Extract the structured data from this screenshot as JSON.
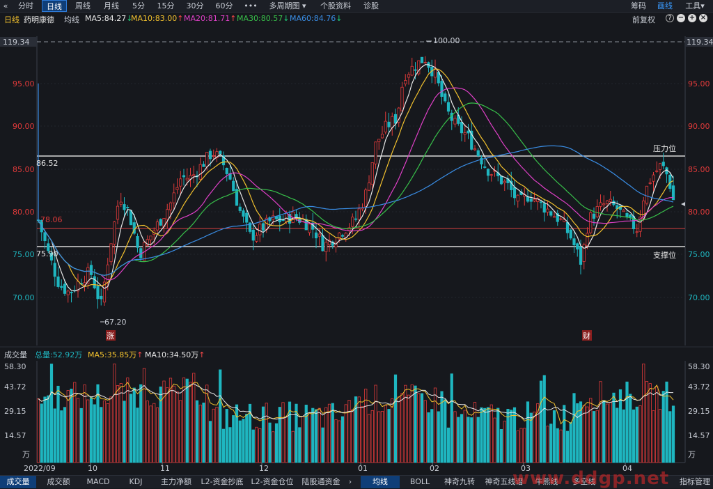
{
  "toolbar": {
    "collapse_icon": "double-chevron-left",
    "periods": [
      "分时",
      "日线",
      "周线",
      "月线",
      "5分",
      "15分",
      "30分",
      "60分",
      "•••"
    ],
    "active_period": "日线",
    "multi_period": "多周期图",
    "stock_info": "个股资料",
    "diagnosis": "诊股",
    "right": [
      "筹码",
      "画线",
      "工具"
    ],
    "right_active": "画线"
  },
  "legend": {
    "period": "日线",
    "stock": "药明康德",
    "ma_label": "均线",
    "ma": [
      {
        "text": "MA5:84.27",
        "arrow": "down",
        "color": "#e8e8e8"
      },
      {
        "text": "MA10:83.00",
        "arrow": "up",
        "color": "#f2c12e"
      },
      {
        "text": "MA20:81.71",
        "arrow": "up",
        "color": "#e040c8"
      },
      {
        "text": "MA30:80.57",
        "arrow": "down",
        "color": "#38c04a"
      },
      {
        "text": "MA60:84.76",
        "arrow": "down",
        "color": "#3a8ee6"
      }
    ],
    "adjust": "前复权",
    "icons": [
      "question-icon",
      "minus-icon",
      "plus-icon",
      "close-icon"
    ]
  },
  "price_axis": {
    "top_value": "119.34",
    "labels": [
      "95.00",
      "90.00",
      "85.00",
      "80.00",
      "75.00",
      "70.00"
    ],
    "max_price_label": "100.00",
    "min_price_label": "67.20"
  },
  "levels": {
    "resistance": {
      "value": "86.52",
      "label": "压力位"
    },
    "support": {
      "value": "75.90",
      "label": "支撑位"
    },
    "red_line": {
      "value": "78.06"
    }
  },
  "markers": [
    "涨",
    "财"
  ],
  "volume": {
    "title": "成交量",
    "total": "总量:52.92万",
    "ma5": "MA5:35.85万",
    "ma10": "MA10:34.50万",
    "axis": [
      "58.30",
      "43.72",
      "29.15",
      "14.57"
    ],
    "unit": "万"
  },
  "x_axis": [
    "2022/09",
    "10",
    "11",
    "12",
    "01",
    "02",
    "03",
    "04"
  ],
  "bottom_tabs": {
    "left": [
      "成交量",
      "成交额",
      "MACD",
      "KDJ",
      "主力净额",
      "L2-资金抄底",
      "L2-资金仓位",
      "陆股通资金"
    ],
    "left_active": "成交量",
    "right": [
      "均线",
      "BOLL",
      "神奇九转",
      "神奇五线谱",
      "牛熊线",
      "多空线"
    ],
    "right_active": "均线",
    "manage": "指标管理"
  },
  "watermark": "www.ddgp.net",
  "colors": {
    "up": "#e03a3a",
    "down": "#1fb6c0",
    "background": "#16181d",
    "accent": "#2e7ad6"
  }
}
